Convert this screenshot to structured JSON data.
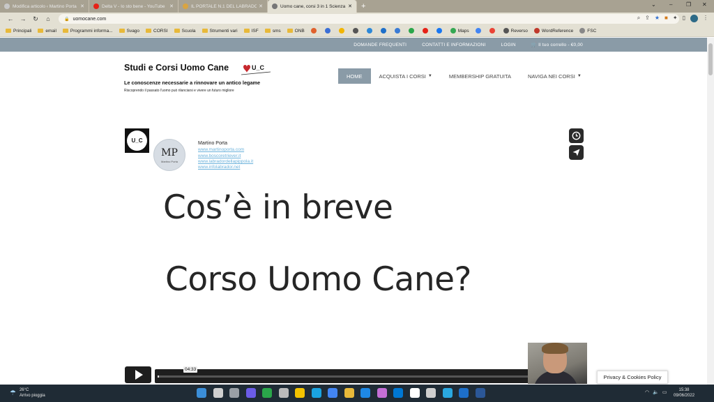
{
  "browser": {
    "tabs": [
      {
        "title": "Modifica articolo ‹ Martino Porta",
        "favicon_color": "#c8c8c8",
        "active": false
      },
      {
        "title": "Delta V - Io sto bene - YouTube",
        "favicon_color": "#e62117",
        "active": false
      },
      {
        "title": "IL PORTALE N.1 DEL LABRADOR",
        "favicon_color": "#d9a441",
        "active": false
      },
      {
        "title": "Uomo cane, corsi 3 in 1 Scienza",
        "favicon_color": "#777777",
        "active": true
      }
    ],
    "new_tab": "+",
    "url": "uomocane.com",
    "bookmarks": [
      {
        "label": "Principali",
        "kind": "folder"
      },
      {
        "label": "email",
        "kind": "folder"
      },
      {
        "label": "Programmi informa...",
        "kind": "folder"
      },
      {
        "label": "Svago",
        "kind": "folder"
      },
      {
        "label": "CORSI",
        "kind": "folder"
      },
      {
        "label": "Scuola",
        "kind": "folder"
      },
      {
        "label": "Strumenti vari",
        "kind": "folder"
      },
      {
        "label": "ISF",
        "kind": "folder"
      },
      {
        "label": "sms",
        "kind": "folder"
      },
      {
        "label": "ONB",
        "kind": "folder"
      },
      {
        "label": "",
        "kind": "dot",
        "color": "#e0612d"
      },
      {
        "label": "",
        "kind": "dot",
        "color": "#3b6fd6"
      },
      {
        "label": "",
        "kind": "dot",
        "color": "#f2b500"
      },
      {
        "label": "",
        "kind": "dot",
        "color": "#555555"
      },
      {
        "label": "",
        "kind": "dot",
        "color": "#2d88d8"
      },
      {
        "label": "",
        "kind": "dot",
        "color": "#1e6fc9"
      },
      {
        "label": "",
        "kind": "dot",
        "color": "#3a7bd5"
      },
      {
        "label": "",
        "kind": "dot",
        "color": "#2aa64a"
      },
      {
        "label": "",
        "kind": "dot",
        "color": "#e62117"
      },
      {
        "label": "",
        "kind": "dot",
        "color": "#1877f2"
      },
      {
        "label": "Maps",
        "kind": "dot",
        "color": "#34a853"
      },
      {
        "label": "",
        "kind": "dot",
        "color": "#4285f4"
      },
      {
        "label": "",
        "kind": "dot",
        "color": "#ea4335"
      },
      {
        "label": "Reverso",
        "kind": "dot",
        "color": "#555555"
      },
      {
        "label": "WordReference",
        "kind": "dot",
        "color": "#c0392b"
      },
      {
        "label": "FSC",
        "kind": "dot",
        "color": "#888888"
      }
    ]
  },
  "site": {
    "top_links": [
      "DOMANDE FREQUENTI",
      "CONTATTI E INFORMAZIONI",
      "LOGIN",
      "Il tuo corrello - €0,00"
    ],
    "title": "Studi e Corsi Uomo Cane",
    "logo_text": "U_C",
    "tagline": "Le conoscenze necessarie a rinnovare un antico legame",
    "subtagline": "Riscoprendo il passato l'uomo può rilanciarsi e vivere un futuro migliore",
    "nav": [
      {
        "label": "HOME",
        "active": true,
        "caret": false
      },
      {
        "label": "ACQUISTA I CORSI",
        "active": false,
        "caret": true
      },
      {
        "label": "MEMBERSHIP GRATUITA",
        "active": false,
        "caret": false
      },
      {
        "label": "NAVIGA NEI CORSI",
        "active": false,
        "caret": true
      }
    ]
  },
  "video": {
    "logo_text": "U_C",
    "avatar_mono": "MP",
    "avatar_signature": "Martino Porta",
    "author": "Martino Porta",
    "links": [
      "www.martinoporta.com",
      "www.boscoretriever.it",
      "www.labradordellapippola.it",
      "www.infolabrador.net"
    ],
    "line1": "Cos’è in breve",
    "line2": "Corso Uomo Cane?",
    "time": "04:33",
    "progress": 0.003
  },
  "privacy_label": "Privacy & Cookies Policy",
  "taskbar": {
    "temp": "26°C",
    "weather": "Arrivo pioggia",
    "time": "15:38",
    "date": "09/06/2022",
    "icon_colors": [
      "#3b8ed8",
      "#cfcfcf",
      "#9aa0a6",
      "#6b5ce7",
      "#2aa64a",
      "#bbbbbb",
      "#f2c200",
      "#1aa3e0",
      "#4285f4",
      "#e8b93a",
      "#1e88e5",
      "#c46fd6",
      "#0078d4",
      "#ffffff",
      "#cfcfcf",
      "#2aa8e0",
      "#1d6fc9",
      "#2b5797"
    ]
  }
}
